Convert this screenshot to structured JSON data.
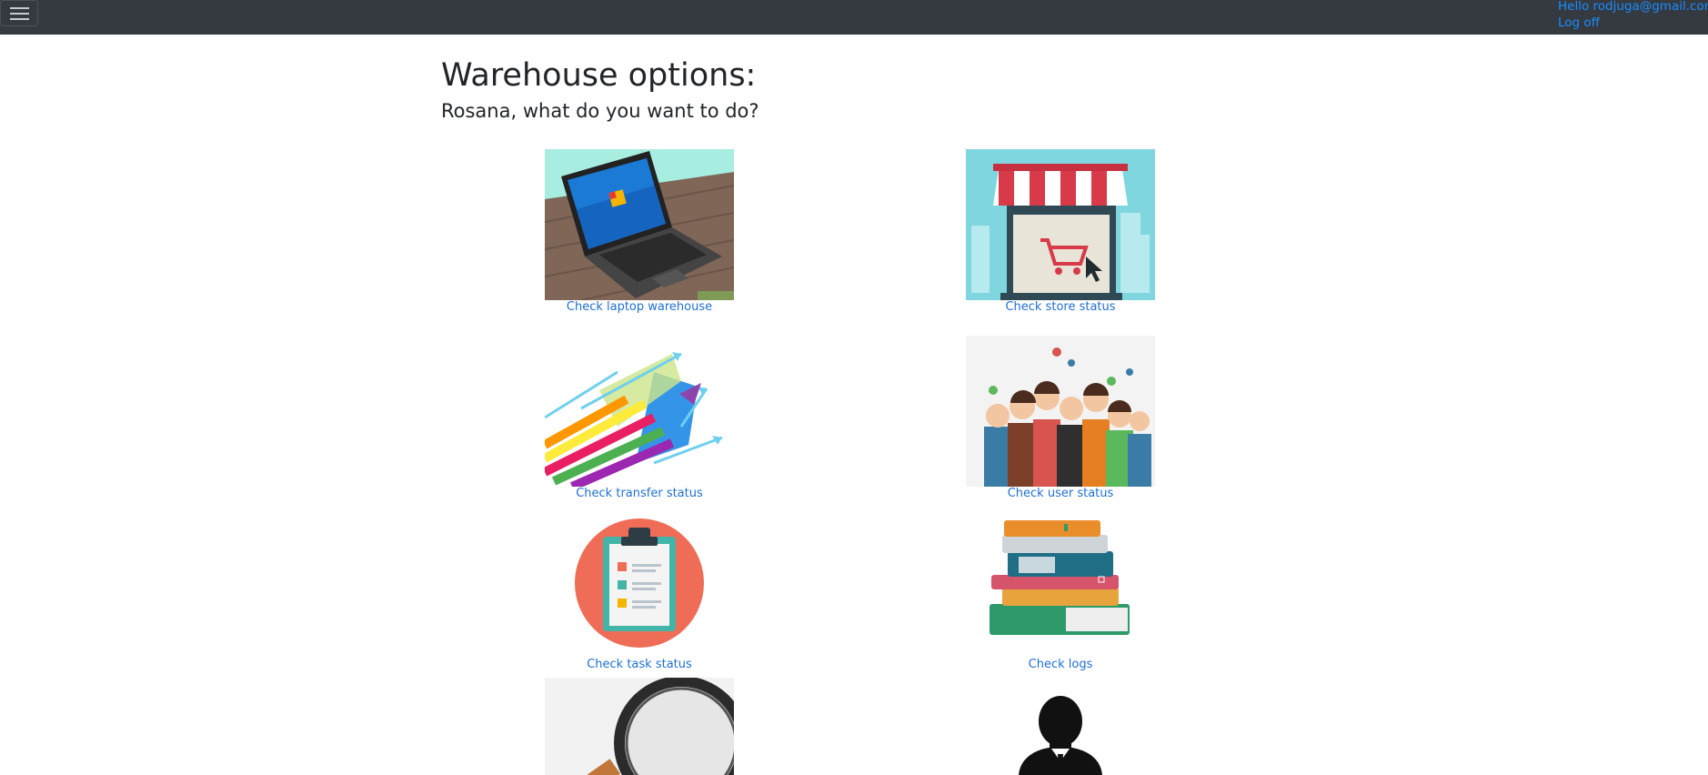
{
  "header": {
    "greeting": "Hello rodjuga@gmail.com!",
    "logoff": "Log off"
  },
  "main": {
    "title": "Warehouse options:",
    "subtitle": "Rosana, what do you want to do?"
  },
  "options": [
    {
      "label": "Check laptop warehouse",
      "icon": "laptop-image"
    },
    {
      "label": "Check store status",
      "icon": "store-image"
    },
    {
      "label": "Check transfer status",
      "icon": "transfer-arrows-image"
    },
    {
      "label": "Check user status",
      "icon": "users-group-image"
    },
    {
      "label": "Check task status",
      "icon": "clipboard-tasks-image"
    },
    {
      "label": "Check logs",
      "icon": "stacked-books-image"
    },
    {
      "label": "",
      "icon": "magnifier-image"
    },
    {
      "label": "",
      "icon": "businessman-silhouette-image"
    }
  ]
}
